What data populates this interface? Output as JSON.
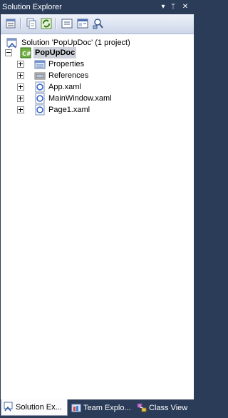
{
  "window": {
    "title": "Solution Explorer",
    "buttons": [
      "▾",
      "ᛘ",
      "✕"
    ]
  },
  "toolbar": {
    "icons": [
      "properties-icon",
      "show-all-files-icon",
      "refresh-icon",
      "view-code-icon",
      "view-designer-icon",
      "class-diagram-icon"
    ]
  },
  "tree": {
    "solution_label": "Solution 'PopUpDoc' (1 project)",
    "project_label": "PopUpDoc",
    "items": [
      {
        "label": "Properties",
        "icon": "properties-folder-icon"
      },
      {
        "label": "References",
        "icon": "references-icon"
      },
      {
        "label": "App.xaml",
        "icon": "xaml-file-icon"
      },
      {
        "label": "MainWindow.xaml",
        "icon": "xaml-file-icon"
      },
      {
        "label": "Page1.xaml",
        "icon": "xaml-file-icon"
      }
    ]
  },
  "tabs": [
    {
      "label": "Solution Ex...",
      "active": true
    },
    {
      "label": "Team Explo...",
      "active": false
    },
    {
      "label": "Class View",
      "active": false
    }
  ]
}
